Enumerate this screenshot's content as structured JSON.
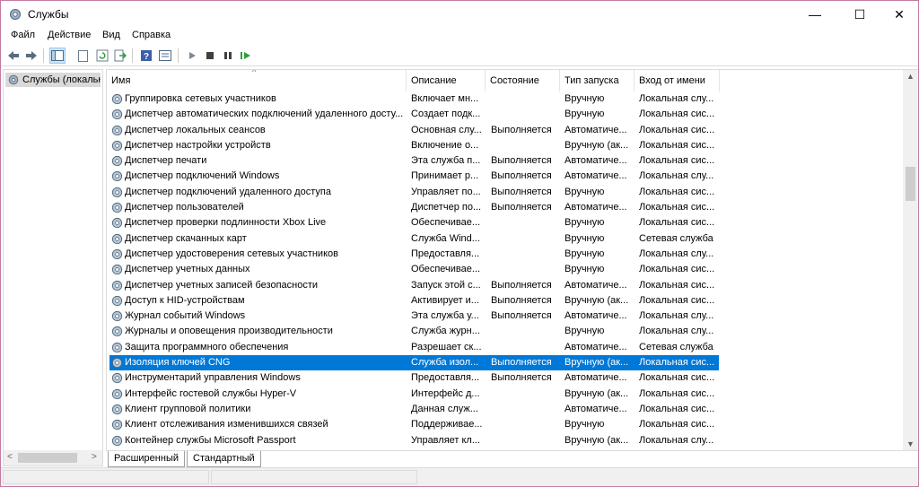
{
  "window": {
    "title": "Службы",
    "app_icon": "gear-icon"
  },
  "title_controls": {
    "minimize": "—",
    "maximize": "☐",
    "close": "✕"
  },
  "menu": [
    "Файл",
    "Действие",
    "Вид",
    "Справка"
  ],
  "toolbar_icons": [
    "back-icon",
    "forward-icon",
    "console-tree-icon",
    "properties-icon",
    "refresh-icon",
    "export-list-icon",
    "help-icon",
    "view-icon",
    "start-icon",
    "stop-icon",
    "pause-icon",
    "restart-icon"
  ],
  "tree": {
    "label": "Службы (локальные)"
  },
  "columns": [
    "Имя",
    "Описание",
    "Состояние",
    "Тип запуска",
    "Вход от имени"
  ],
  "services": [
    {
      "name": "Группировка сетевых участников",
      "desc": "Включает мн...",
      "state": "",
      "start": "Вручную",
      "logon": "Локальная слу..."
    },
    {
      "name": "Диспетчер автоматических подключений удаленного досту...",
      "desc": "Создает подк...",
      "state": "",
      "start": "Вручную",
      "logon": "Локальная сис..."
    },
    {
      "name": "Диспетчер локальных сеансов",
      "desc": "Основная слу...",
      "state": "Выполняется",
      "start": "Автоматиче...",
      "logon": "Локальная сис..."
    },
    {
      "name": "Диспетчер настройки устройств",
      "desc": "Включение о...",
      "state": "",
      "start": "Вручную (ак...",
      "logon": "Локальная сис..."
    },
    {
      "name": "Диспетчер печати",
      "desc": "Эта служба п...",
      "state": "Выполняется",
      "start": "Автоматиче...",
      "logon": "Локальная сис..."
    },
    {
      "name": "Диспетчер подключений Windows",
      "desc": "Принимает р...",
      "state": "Выполняется",
      "start": "Автоматиче...",
      "logon": "Локальная слу..."
    },
    {
      "name": "Диспетчер подключений удаленного доступа",
      "desc": "Управляет по...",
      "state": "Выполняется",
      "start": "Вручную",
      "logon": "Локальная сис..."
    },
    {
      "name": "Диспетчер пользователей",
      "desc": "Диспетчер по...",
      "state": "Выполняется",
      "start": "Автоматиче...",
      "logon": "Локальная сис..."
    },
    {
      "name": "Диспетчер проверки подлинности Xbox Live",
      "desc": "Обеспечивае...",
      "state": "",
      "start": "Вручную",
      "logon": "Локальная сис..."
    },
    {
      "name": "Диспетчер скачанных карт",
      "desc": "Служба Wind...",
      "state": "",
      "start": "Вручную",
      "logon": "Сетевая служба"
    },
    {
      "name": "Диспетчер удостоверения сетевых участников",
      "desc": "Предоставля...",
      "state": "",
      "start": "Вручную",
      "logon": "Локальная слу..."
    },
    {
      "name": "Диспетчер учетных данных",
      "desc": "Обеспечивае...",
      "state": "",
      "start": "Вручную",
      "logon": "Локальная сис..."
    },
    {
      "name": "Диспетчер учетных записей безопасности",
      "desc": "Запуск этой с...",
      "state": "Выполняется",
      "start": "Автоматиче...",
      "logon": "Локальная сис..."
    },
    {
      "name": "Доступ к HID-устройствам",
      "desc": "Активирует и...",
      "state": "Выполняется",
      "start": "Вручную (ак...",
      "logon": "Локальная сис..."
    },
    {
      "name": "Журнал событий Windows",
      "desc": "Эта служба у...",
      "state": "Выполняется",
      "start": "Автоматиче...",
      "logon": "Локальная слу..."
    },
    {
      "name": "Журналы и оповещения производительности",
      "desc": "Служба журн...",
      "state": "",
      "start": "Вручную",
      "logon": "Локальная слу..."
    },
    {
      "name": "Защита программного обеспечения",
      "desc": "Разрешает ск...",
      "state": "",
      "start": "Автоматиче...",
      "logon": "Сетевая служба"
    },
    {
      "name": "Изоляция ключей CNG",
      "desc": "Служба изол...",
      "state": "Выполняется",
      "start": "Вручную (ак...",
      "logon": "Локальная сис...",
      "selected": true
    },
    {
      "name": "Инструментарий управления Windows",
      "desc": "Предоставля...",
      "state": "Выполняется",
      "start": "Автоматиче...",
      "logon": "Локальная сис..."
    },
    {
      "name": "Интерфейс гостевой службы Hyper-V",
      "desc": "Интерфейс д...",
      "state": "",
      "start": "Вручную (ак...",
      "logon": "Локальная сис..."
    },
    {
      "name": "Клиент групповой политики",
      "desc": "Данная служ...",
      "state": "",
      "start": "Автоматиче...",
      "logon": "Локальная сис..."
    },
    {
      "name": "Клиент отслеживания изменившихся связей",
      "desc": "Поддерживае...",
      "state": "",
      "start": "Вручную",
      "logon": "Локальная сис..."
    },
    {
      "name": "Контейнер службы Microsoft Passport",
      "desc": "Управляет кл...",
      "state": "",
      "start": "Вручную (ак...",
      "logon": "Локальная слу..."
    }
  ],
  "tabs": [
    "Расширенный",
    "Стандартный"
  ]
}
